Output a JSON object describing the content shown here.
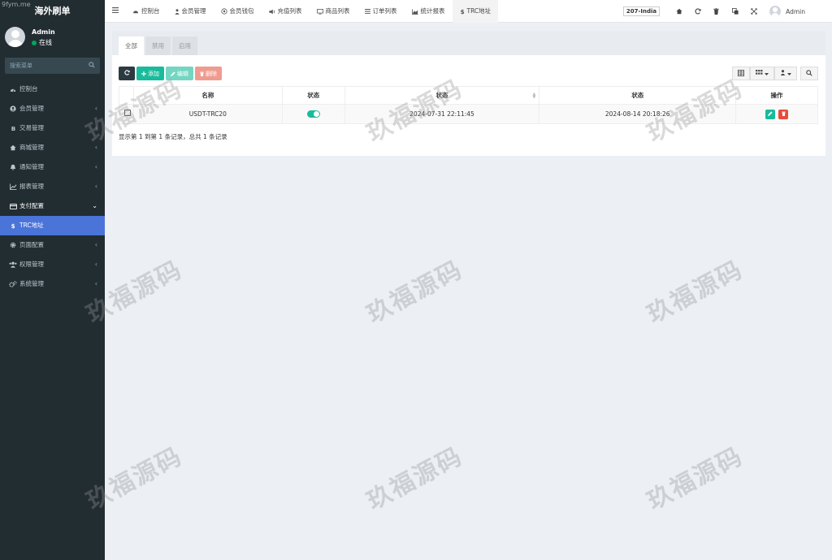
{
  "corner_mark": "9fym.me",
  "app": {
    "title": "海外刷单"
  },
  "user": {
    "name": "Admin",
    "status": "在线"
  },
  "sidebar": {
    "search_placeholder": "搜索菜单",
    "items": [
      {
        "label": "控制台",
        "icon": "dashboard-icon"
      },
      {
        "label": "会员管理",
        "icon": "user-circle-icon"
      },
      {
        "label": "交易管理",
        "icon": "bitcoin-icon"
      },
      {
        "label": "商城管理",
        "icon": "home-icon"
      },
      {
        "label": "通知管理",
        "icon": "bell-icon"
      },
      {
        "label": "报表管理",
        "icon": "line-chart-icon"
      },
      {
        "label": "支付配置",
        "icon": "credit-card-icon"
      },
      {
        "label": "TRC地址",
        "icon": "dollar-icon"
      },
      {
        "label": "页面配置",
        "icon": "gear-icon"
      },
      {
        "label": "权限管理",
        "icon": "users-icon"
      },
      {
        "label": "系统管理",
        "icon": "cogs-icon"
      }
    ]
  },
  "navbar": {
    "tabs": [
      {
        "label": "控制台",
        "icon": "dashboard-icon"
      },
      {
        "label": "会员管理",
        "icon": "user-icon"
      },
      {
        "label": "会员钱包",
        "icon": "wallet-icon"
      },
      {
        "label": "充值列表",
        "icon": "volume-icon"
      },
      {
        "label": "商品列表",
        "icon": "monitor-icon"
      },
      {
        "label": "订单列表",
        "icon": "list-icon"
      },
      {
        "label": "统计报表",
        "icon": "area-chart-icon"
      },
      {
        "label": "TRC地址",
        "icon": "dollar-icon"
      }
    ],
    "site_badge": "207-India",
    "user_name": "Admin"
  },
  "panel": {
    "tabs": [
      "全部",
      "禁用",
      "启用"
    ],
    "buttons": {
      "add": "添加",
      "edit": "编辑",
      "delete": "删除"
    },
    "table": {
      "headers": [
        "名称",
        "状态",
        "状态",
        "状态",
        "操作"
      ],
      "rows": [
        {
          "name": "USDT-TRC20",
          "status_on": true,
          "created": "2024-07-31 22:11:45",
          "updated": "2024-08-14 20:18:26"
        }
      ]
    },
    "pager_text": "显示第 1 到第 1 条记录，总共 1 条记录"
  },
  "watermark": "玖福源码"
}
